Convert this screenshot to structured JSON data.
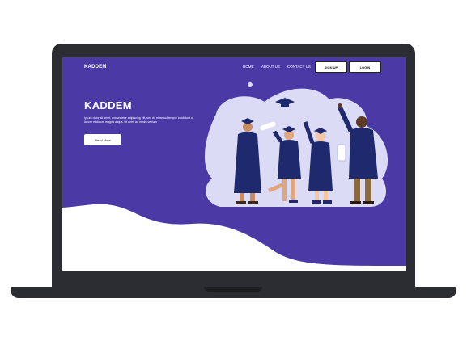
{
  "nav": {
    "brand": "KADDEM",
    "links": [
      "HOME",
      "ABOUT US",
      "CONTACT US"
    ],
    "signup_label": "SIGN UP",
    "login_label": "LOGIN"
  },
  "hero": {
    "title": "KADDEM",
    "body": "ipsum dolor sit amet, consectetur adipiscing elit, sed do eiusmod tempor incididunt ut labore et dolore magna aliqua. Ut enim ad minim veniam",
    "cta_label": "Read More"
  },
  "colors": {
    "hero_bg": "#4b3aa6",
    "blob": "#dcdbf6",
    "gown": "#1f2a6e",
    "device": "#2b2d33"
  },
  "icons": [
    "graduation-cap-icon",
    "diploma-scroll-icon"
  ]
}
